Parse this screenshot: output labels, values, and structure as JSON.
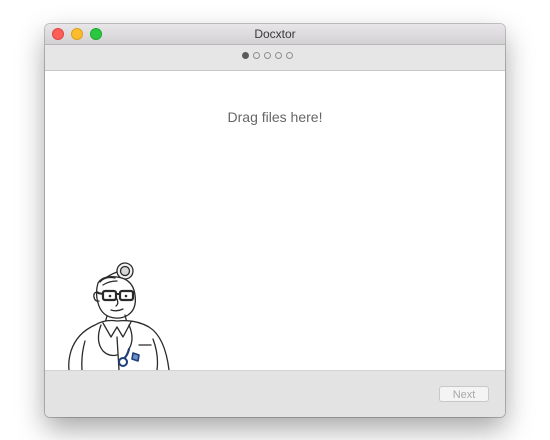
{
  "window": {
    "title": "Docxtor"
  },
  "wizard": {
    "steps_total": 5,
    "current_step": 1
  },
  "content": {
    "drop_text": "Drag files here!"
  },
  "footer": {
    "next_label": "Next",
    "next_enabled": false
  },
  "colors": {
    "close": "#fc5f57",
    "minimize": "#fdbc2e",
    "maximize": "#2ac840",
    "active_dot": "#5b5b5b"
  },
  "icons": {
    "illustration": "doctor-mascot-illustration"
  }
}
